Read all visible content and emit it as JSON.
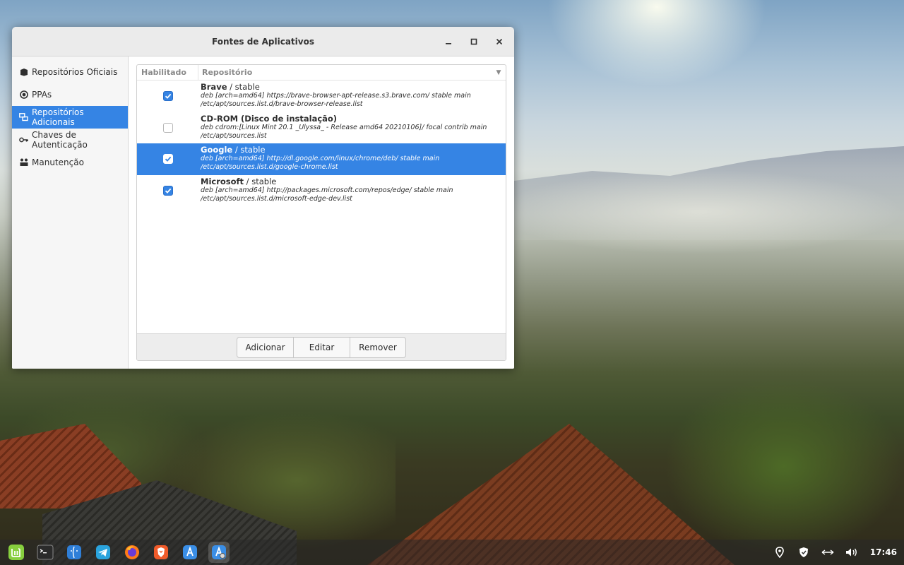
{
  "window": {
    "title": "Fontes de Aplicativos",
    "minimize": "_",
    "maximize": "□",
    "close": "✕"
  },
  "sidebar": {
    "items": [
      {
        "label": "Repositórios Oficiais",
        "icon": "package-icon",
        "active": false
      },
      {
        "label": "PPAs",
        "icon": "target-icon",
        "active": false
      },
      {
        "label": "Repositórios Adicionais",
        "icon": "network-icon",
        "active": true
      },
      {
        "label": "Chaves de Autenticação",
        "icon": "key-icon",
        "active": false
      },
      {
        "label": "Manutenção",
        "icon": "tools-icon",
        "active": false
      }
    ]
  },
  "table": {
    "headers": {
      "enabled": "Habilitado",
      "repository": "Repositório"
    },
    "rows": [
      {
        "name": "Brave",
        "suffix": " / stable",
        "enabled": true,
        "selected": false,
        "line1": "deb [arch=amd64] https://brave-browser-apt-release.s3.brave.com/ stable main",
        "line2": "/etc/apt/sources.list.d/brave-browser-release.list"
      },
      {
        "name": "CD-ROM (Disco de instalação)",
        "suffix": "",
        "enabled": false,
        "selected": false,
        "line1": "deb cdrom:[Linux Mint 20.1 _Ulyssa_ - Release amd64 20210106]/ focal contrib main",
        "line2": "/etc/apt/sources.list"
      },
      {
        "name": "Google",
        "suffix": " / stable",
        "enabled": true,
        "selected": true,
        "line1": "deb [arch=amd64] http://dl.google.com/linux/chrome/deb/ stable main",
        "line2": "/etc/apt/sources.list.d/google-chrome.list"
      },
      {
        "name": "Microsoft",
        "suffix": " / stable",
        "enabled": true,
        "selected": false,
        "line1": "deb [arch=amd64] http://packages.microsoft.com/repos/edge/ stable main",
        "line2": "/etc/apt/sources.list.d/microsoft-edge-dev.list"
      }
    ]
  },
  "toolbar": {
    "add": "Adicionar",
    "edit": "Editar",
    "remove": "Remover"
  },
  "taskbar": {
    "launchers": [
      "mint-menu-icon",
      "terminal-icon",
      "files-icon",
      "telegram-icon",
      "firefox-icon",
      "brave-icon",
      "software-manager-icon",
      "software-sources-icon"
    ],
    "clock": "17:46"
  },
  "colors": {
    "accent": "#3584e4"
  }
}
